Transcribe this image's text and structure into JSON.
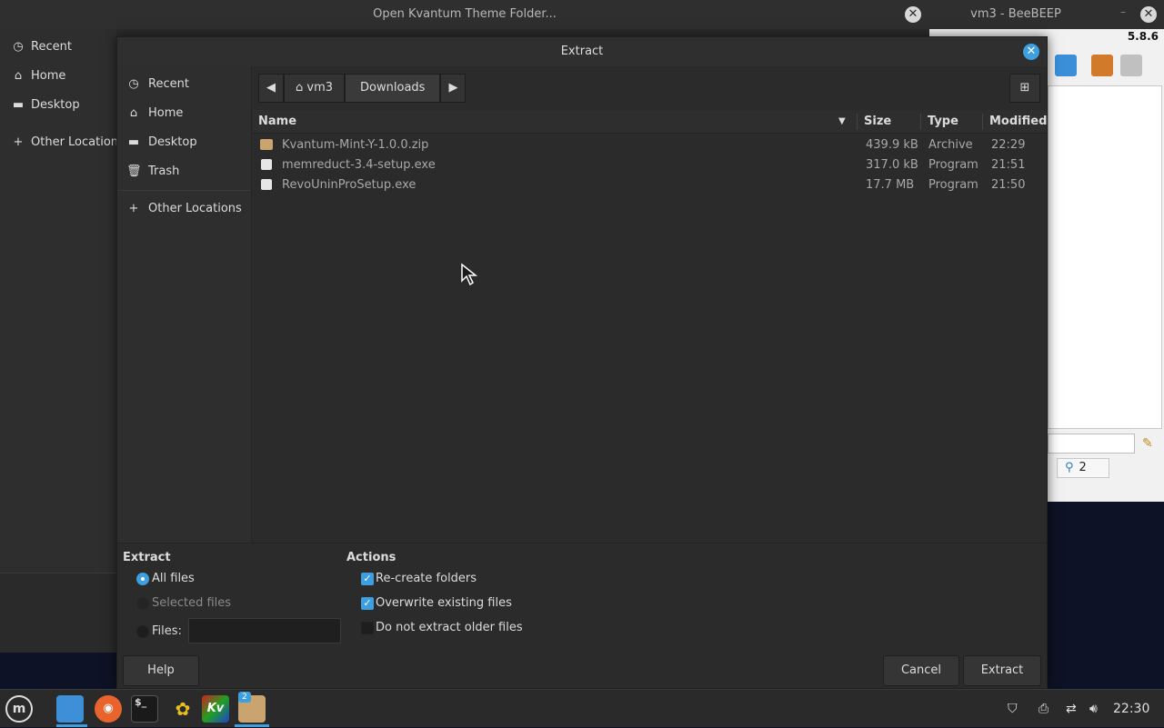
{
  "bg_window": {
    "title": "Open Kvantum Theme Folder...",
    "sidebar": [
      {
        "icon": "clock-icon",
        "label": "Recent"
      },
      {
        "icon": "home-icon",
        "label": "Home"
      },
      {
        "icon": "desktop-icon",
        "label": "Desktop"
      },
      {
        "icon": "plus-icon",
        "label": "Other Locations"
      }
    ]
  },
  "beebeep": {
    "title": "vm3 - BeeBEEP",
    "version": "5.8.6",
    "user_count": "2"
  },
  "dialog": {
    "title": "Extract",
    "sidebar": [
      {
        "icon": "clock-icon",
        "label": "Recent"
      },
      {
        "icon": "home-icon",
        "label": "Home"
      },
      {
        "icon": "desktop-icon",
        "label": "Desktop"
      },
      {
        "icon": "trash-icon",
        "label": "Trash"
      },
      {
        "icon": "plus-icon",
        "label": "Other Locations"
      }
    ],
    "path": [
      "vm3",
      "Downloads"
    ],
    "columns": {
      "name": "Name",
      "size": "Size",
      "type": "Type",
      "modified": "Modified"
    },
    "files": [
      {
        "name": "Kvantum-Mint-Y-1.0.0.zip",
        "size": "439.9 kB",
        "type": "Archive",
        "modified": "22:29",
        "icon": "archive"
      },
      {
        "name": "memreduct-3.4-setup.exe",
        "size": "317.0 kB",
        "type": "Program",
        "modified": "21:51",
        "icon": "program"
      },
      {
        "name": "RevoUninProSetup.exe",
        "size": "17.7 MB",
        "type": "Program",
        "modified": "21:50",
        "icon": "program"
      }
    ],
    "extract": {
      "heading": "Extract",
      "all_files": "All files",
      "selected_files": "Selected files",
      "files_label": "Files:",
      "files_value": ""
    },
    "actions": {
      "heading": "Actions",
      "recreate": "Re-create folders",
      "recreate_checked": true,
      "overwrite": "Overwrite existing files",
      "overwrite_checked": true,
      "no_older": "Do not extract older files",
      "no_older_checked": false
    },
    "buttons": {
      "help": "Help",
      "cancel": "Cancel",
      "extract": "Extract"
    }
  },
  "taskbar": {
    "clock": "22:30",
    "workspace_badge": "2"
  }
}
